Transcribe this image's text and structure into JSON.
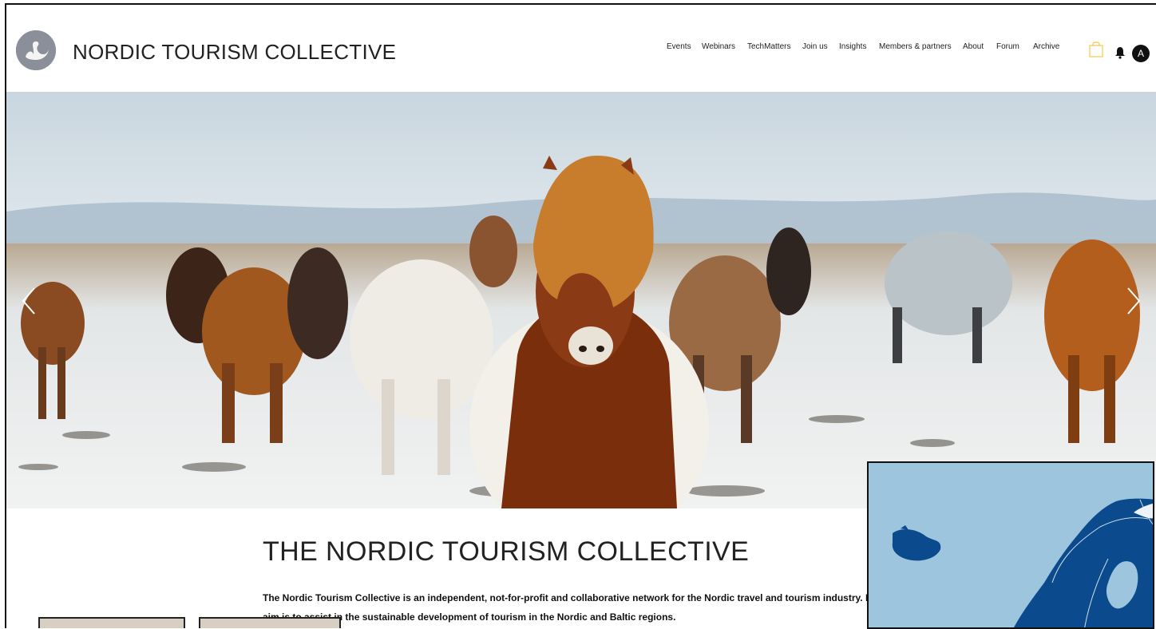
{
  "header": {
    "site_title": "NORDIC TOURISM COLLECTIVE",
    "logo_icon": "swan-logo-icon",
    "avatar_letter": "A"
  },
  "nav": {
    "items": [
      {
        "label": "Events"
      },
      {
        "label": "Webinars"
      },
      {
        "label": "TechMatters"
      },
      {
        "label": "Join us"
      },
      {
        "label": "Insights"
      },
      {
        "label": "Members & partners"
      },
      {
        "label": "About"
      },
      {
        "label": "Forum"
      },
      {
        "label": "Archive"
      }
    ]
  },
  "icons": {
    "cart": "shopping-bag-icon",
    "notifications": "bell-icon",
    "prev": "chevron-left-icon",
    "next": "chevron-right-icon"
  },
  "hero": {
    "image": "icelandic-horses-in-snow"
  },
  "main": {
    "title": "THE NORDIC TOURISM COLLECTIVE",
    "intro": "The Nordic Tourism Collective is an independent, not-for-profit and collaborative network for the Nordic travel and tourism industry. I aim is to assist in the sustainable development of tourism in the Nordic and Baltic regions."
  },
  "colors": {
    "map_sea": "#9dc6de",
    "map_land": "#0b4a8c",
    "bag_accent": "#f2c94c"
  }
}
